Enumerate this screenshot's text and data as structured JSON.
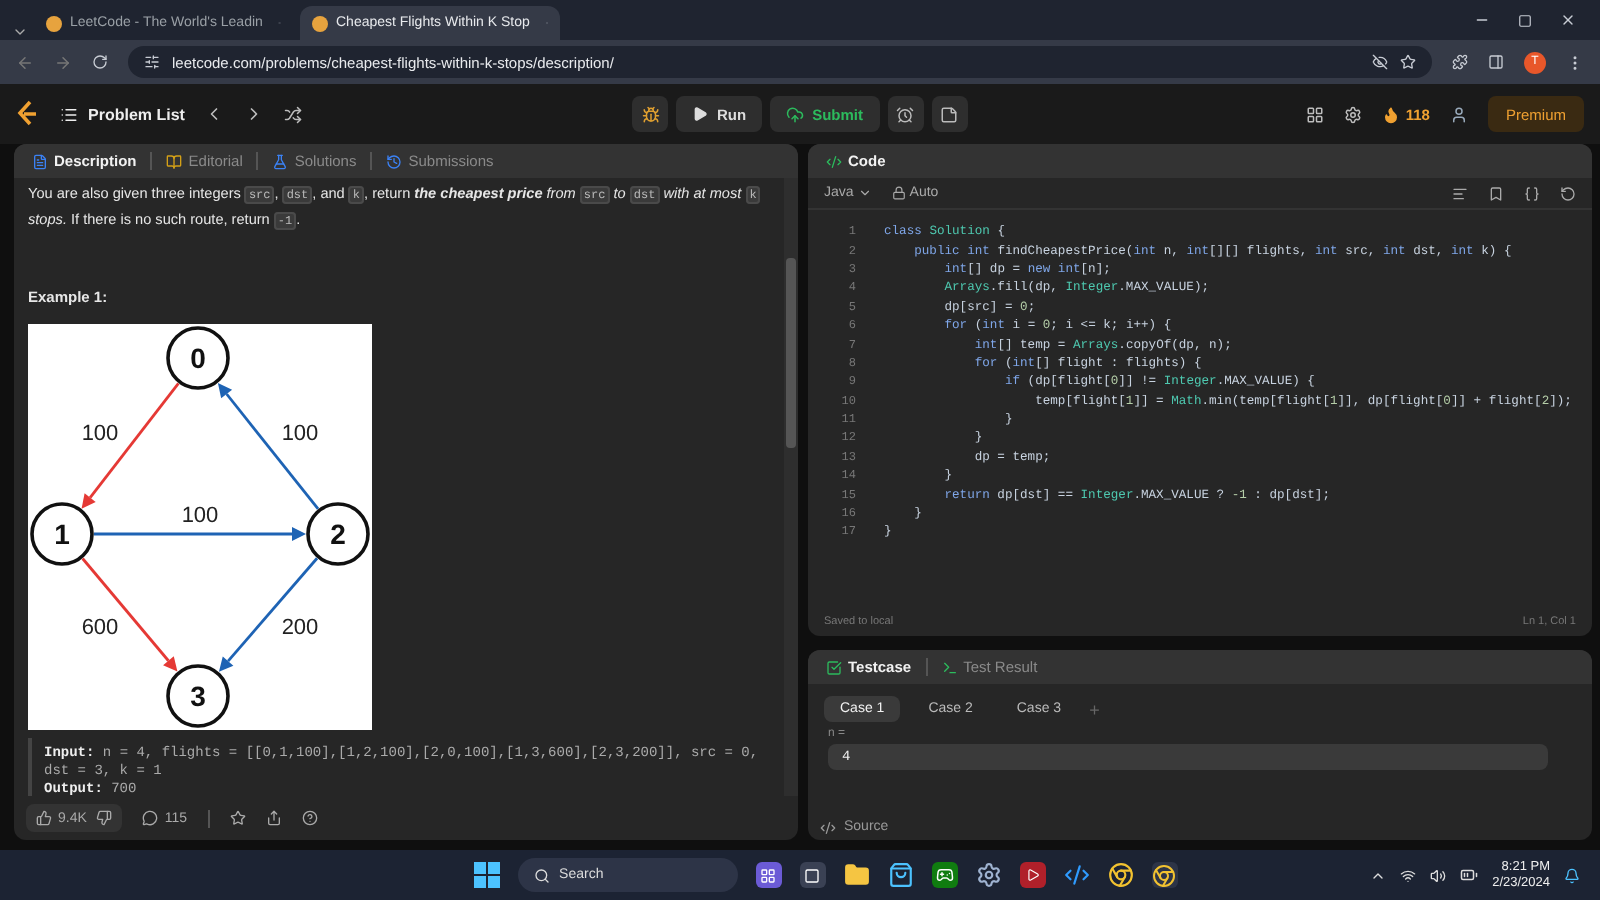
{
  "browser": {
    "tabs": [
      {
        "title": "LeetCode - The World's Leadin",
        "selected": false
      },
      {
        "title": "Cheapest Flights Within K Stop",
        "selected": true
      }
    ],
    "url": "leetcode.com/problems/cheapest-flights-within-k-stops/description/",
    "profile_initial": "T"
  },
  "top_bar": {
    "problem_list": "Problem List",
    "run": "Run",
    "submit": "Submit",
    "streak": "118",
    "premium": "Premium"
  },
  "description_panel": {
    "tabs": [
      {
        "label": "Description",
        "selected": true
      },
      {
        "label": "Editorial",
        "selected": false
      },
      {
        "label": "Solutions",
        "selected": false
      },
      {
        "label": "Submissions",
        "selected": false
      }
    ],
    "paragraph": [
      {
        "kind": "text",
        "text": "You are also given three integers "
      },
      {
        "kind": "code",
        "text": "src"
      },
      {
        "kind": "text",
        "text": ", "
      },
      {
        "kind": "code",
        "text": "dst"
      },
      {
        "kind": "text",
        "text": ", and "
      },
      {
        "kind": "code",
        "text": "k"
      },
      {
        "kind": "text",
        "text": ", return **the cheapest price** *from* "
      },
      {
        "kind": "code",
        "text": "src"
      },
      {
        "kind": "text",
        "text": " *to* "
      },
      {
        "kind": "code",
        "text": "dst"
      },
      {
        "kind": "text",
        "text": " *with at most* "
      },
      {
        "kind": "code",
        "text": "k"
      },
      {
        "kind": "text",
        "text": " *stops.* If there is no such route, return "
      },
      {
        "kind": "code",
        "text": "-1"
      },
      {
        "kind": "text",
        "text": "."
      }
    ],
    "example_title": "Example 1:",
    "figure": {
      "nodes": [
        {
          "label": "0"
        },
        {
          "label": "1"
        },
        {
          "label": "2"
        },
        {
          "label": "3"
        }
      ],
      "edges": [
        {
          "label": "100",
          "color": "#e53935"
        },
        {
          "label": "100",
          "color": "#1e63b4"
        },
        {
          "label": "100",
          "color": "#1e63b4"
        },
        {
          "label": "600",
          "color": "#e53935"
        },
        {
          "label": "200",
          "color": "#1e63b4"
        }
      ]
    },
    "example_lines": [
      "**Input:** n = 4, flights = [[0,1,100],[1,2,100],[2,0,100],[1,3,600],[2,3,200]], src = 0, dst = 3, k = 1",
      "**Output:** 700"
    ],
    "likes": "9.4K",
    "comments": "115"
  },
  "code_panel": {
    "title": "Code",
    "language": "Java",
    "mode": "Auto",
    "lines": [
      {
        "number": "1",
        "tokens": [
          {
            "kind": "kw",
            "text": "class "
          },
          {
            "kind": "type",
            "text": "Solution"
          },
          {
            "kind": "plain",
            "text": " {"
          }
        ]
      },
      {
        "number": "2",
        "tokens": [
          {
            "kind": "kw",
            "text": "    public int "
          },
          {
            "kind": "plain",
            "text": "findCheapestPrice("
          },
          {
            "kind": "kw",
            "text": "int "
          },
          {
            "kind": "plain",
            "text": "n, "
          },
          {
            "kind": "kw",
            "text": "int"
          },
          {
            "kind": "plain",
            "text": "[][] flights, "
          },
          {
            "kind": "kw",
            "text": "int "
          },
          {
            "kind": "plain",
            "text": "src, "
          },
          {
            "kind": "kw",
            "text": "int "
          },
          {
            "kind": "plain",
            "text": "dst, "
          },
          {
            "kind": "kw",
            "text": "int "
          },
          {
            "kind": "plain",
            "text": "k) {"
          }
        ]
      },
      {
        "number": "3",
        "tokens": [
          {
            "kind": "kw",
            "text": "        int"
          },
          {
            "kind": "plain",
            "text": "[] dp = "
          },
          {
            "kind": "kw",
            "text": "new int"
          },
          {
            "kind": "plain",
            "text": "[n];"
          }
        ]
      },
      {
        "number": "4",
        "tokens": [
          {
            "kind": "type",
            "text": "        Arrays"
          },
          {
            "kind": "plain",
            "text": ".fill(dp, "
          },
          {
            "kind": "type",
            "text": "Integer"
          },
          {
            "kind": "plain",
            "text": ".MAX_VALUE);"
          }
        ]
      },
      {
        "number": "5",
        "tokens": [
          {
            "kind": "plain",
            "text": "        dp[src] = "
          },
          {
            "kind": "num",
            "text": "0"
          },
          {
            "kind": "plain",
            "text": ";"
          }
        ]
      },
      {
        "number": "6",
        "tokens": [
          {
            "kind": "kw",
            "text": "        for"
          },
          {
            "kind": "plain",
            "text": " ("
          },
          {
            "kind": "kw",
            "text": "int"
          },
          {
            "kind": "plain",
            "text": " i = "
          },
          {
            "kind": "num",
            "text": "0"
          },
          {
            "kind": "plain",
            "text": "; i <= k; i++) {"
          }
        ]
      },
      {
        "number": "7",
        "tokens": [
          {
            "kind": "kw",
            "text": "            int"
          },
          {
            "kind": "plain",
            "text": "[] temp = "
          },
          {
            "kind": "type",
            "text": "Arrays"
          },
          {
            "kind": "plain",
            "text": ".copyOf(dp, n);"
          }
        ]
      },
      {
        "number": "8",
        "tokens": [
          {
            "kind": "kw",
            "text": "            for"
          },
          {
            "kind": "plain",
            "text": " ("
          },
          {
            "kind": "kw",
            "text": "int"
          },
          {
            "kind": "plain",
            "text": "[] flight : flights) {"
          }
        ]
      },
      {
        "number": "9",
        "tokens": [
          {
            "kind": "kw",
            "text": "                if"
          },
          {
            "kind": "plain",
            "text": " (dp[flight["
          },
          {
            "kind": "num",
            "text": "0"
          },
          {
            "kind": "plain",
            "text": "]] != "
          },
          {
            "kind": "type",
            "text": "Integer"
          },
          {
            "kind": "plain",
            "text": ".MAX_VALUE) {"
          }
        ]
      },
      {
        "number": "10",
        "tokens": [
          {
            "kind": "plain",
            "text": "                    temp[flight["
          },
          {
            "kind": "num",
            "text": "1"
          },
          {
            "kind": "plain",
            "text": "]] = "
          },
          {
            "kind": "type",
            "text": "Math"
          },
          {
            "kind": "plain",
            "text": ".min(temp[flight["
          },
          {
            "kind": "num",
            "text": "1"
          },
          {
            "kind": "plain",
            "text": "]], dp[flight["
          },
          {
            "kind": "num",
            "text": "0"
          },
          {
            "kind": "plain",
            "text": "]] + flight["
          },
          {
            "kind": "num",
            "text": "2"
          },
          {
            "kind": "plain",
            "text": "]);"
          }
        ]
      },
      {
        "number": "11",
        "tokens": [
          {
            "kind": "plain",
            "text": "                }"
          }
        ]
      },
      {
        "number": "12",
        "tokens": [
          {
            "kind": "plain",
            "text": "            }"
          }
        ]
      },
      {
        "number": "13",
        "tokens": [
          {
            "kind": "plain",
            "text": "            dp = temp;"
          }
        ]
      },
      {
        "number": "14",
        "tokens": [
          {
            "kind": "plain",
            "text": "        }"
          }
        ]
      },
      {
        "number": "15",
        "tokens": [
          {
            "kind": "kw",
            "text": "        return"
          },
          {
            "kind": "plain",
            "text": " dp[dst] == "
          },
          {
            "kind": "type",
            "text": "Integer"
          },
          {
            "kind": "plain",
            "text": ".MAX_VALUE ? "
          },
          {
            "kind": "num",
            "text": "-1"
          },
          {
            "kind": "plain",
            "text": " : dp[dst];"
          }
        ]
      },
      {
        "number": "16",
        "tokens": [
          {
            "kind": "plain",
            "text": "    }"
          }
        ]
      },
      {
        "number": "17",
        "tokens": [
          {
            "kind": "plain",
            "text": "}"
          }
        ]
      }
    ],
    "status": "Saved to local",
    "cursor": "Ln 1, Col 1"
  },
  "testcase_panel": {
    "tabs": [
      {
        "label": "Testcase",
        "selected": true
      },
      {
        "label": "Test Result",
        "selected": false
      }
    ],
    "cases": [
      {
        "label": "Case 1",
        "selected": true
      },
      {
        "label": "Case 2",
        "selected": false
      },
      {
        "label": "Case 3",
        "selected": false
      }
    ],
    "add_case": "+",
    "parameter_label": "n =",
    "parameter_value": "4",
    "footer": "Source"
  },
  "taskbar": {
    "search": "Search",
    "time": "8:21 PM",
    "date": "2/23/2024"
  }
}
